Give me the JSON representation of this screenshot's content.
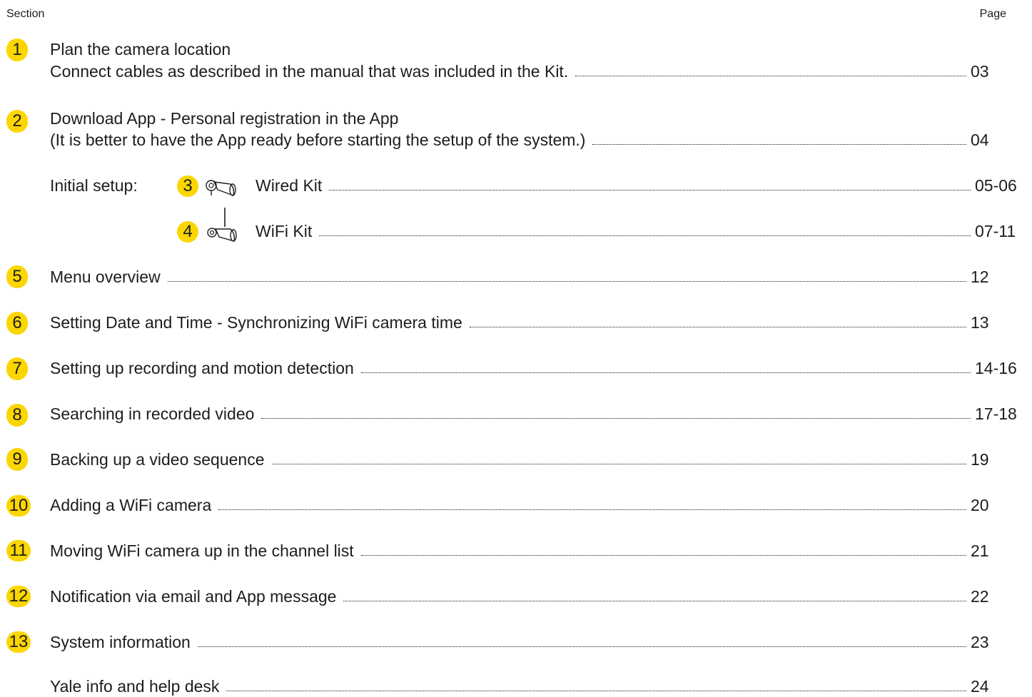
{
  "header": {
    "section_label": "Section",
    "page_label": "Page"
  },
  "sections": [
    {
      "num": "1",
      "line1": "Plan the camera location",
      "title": "Connect cables as described in the manual that was included in the Kit.",
      "page": "03"
    },
    {
      "num": "2",
      "line1": "Download App - Personal registration in the App",
      "title": "(It is better to have the App ready before starting the setup of the system.)",
      "page": "04"
    },
    {
      "label": "Initial setup:"
    },
    {
      "num": "3",
      "icon": "wired-camera-icon",
      "title": "Wired Kit",
      "page": "05-06"
    },
    {
      "num": "4",
      "icon": "wifi-camera-icon",
      "title": "WiFi Kit",
      "page": "07-11"
    },
    {
      "num": "5",
      "title": "Menu overview",
      "page": "12"
    },
    {
      "num": "6",
      "title": "Setting Date and Time - Synchronizing WiFi camera time",
      "page": "13"
    },
    {
      "num": "7",
      "title": "Setting up recording and motion detection",
      "page": "14-16"
    },
    {
      "num": "8",
      "title": "Searching in recorded video",
      "page": "17-18"
    },
    {
      "num": "9",
      "title": "Backing up a video sequence",
      "page": "19"
    },
    {
      "num": "10",
      "title": "Adding a WiFi camera",
      "page": "20"
    },
    {
      "num": "11",
      "title": "Moving WiFi camera up in the channel list",
      "page": "21"
    },
    {
      "num": "12",
      "title": "Notification via email and App message",
      "page": "22"
    },
    {
      "num": "13",
      "title": "System information",
      "page": "23"
    },
    {
      "title": "Yale info and help desk",
      "page": "24"
    }
  ],
  "accent_color": "#fcd600"
}
